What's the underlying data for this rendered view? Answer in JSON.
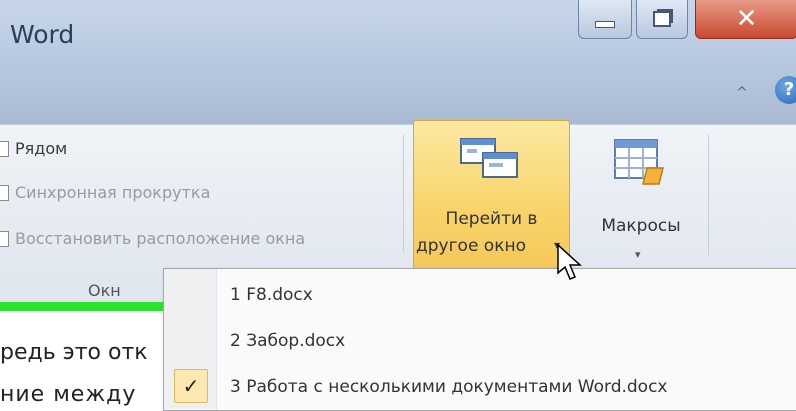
{
  "window": {
    "title": "Word",
    "help_glyph": "?",
    "collapse_glyph": "^"
  },
  "ribbon": {
    "window_group": {
      "side_by_side": "Рядом",
      "sync_scroll": "Синхронная прокрутка",
      "reset_position": "Восстановить расположение окна",
      "group_label": "Окн"
    },
    "switch_windows": {
      "label_line1": "Перейти в",
      "label_line2": "другое окно",
      "arrow": "▾"
    },
    "macros": {
      "label": "Макросы",
      "arrow": "▾"
    }
  },
  "menu": {
    "items": [
      {
        "label": "1 F8.docx",
        "checked": false
      },
      {
        "label": "2 Забор.docx",
        "checked": false
      },
      {
        "label": "3 Работа с несколькими документами Word.docx",
        "checked": true
      }
    ],
    "check_glyph": "✓"
  },
  "document": {
    "line1": "редь это отк",
    "line2": "ние  между"
  },
  "colors": {
    "highlight": "#f8d46a",
    "accent_line": "#2ee02e",
    "close_button": "#c94a30"
  }
}
